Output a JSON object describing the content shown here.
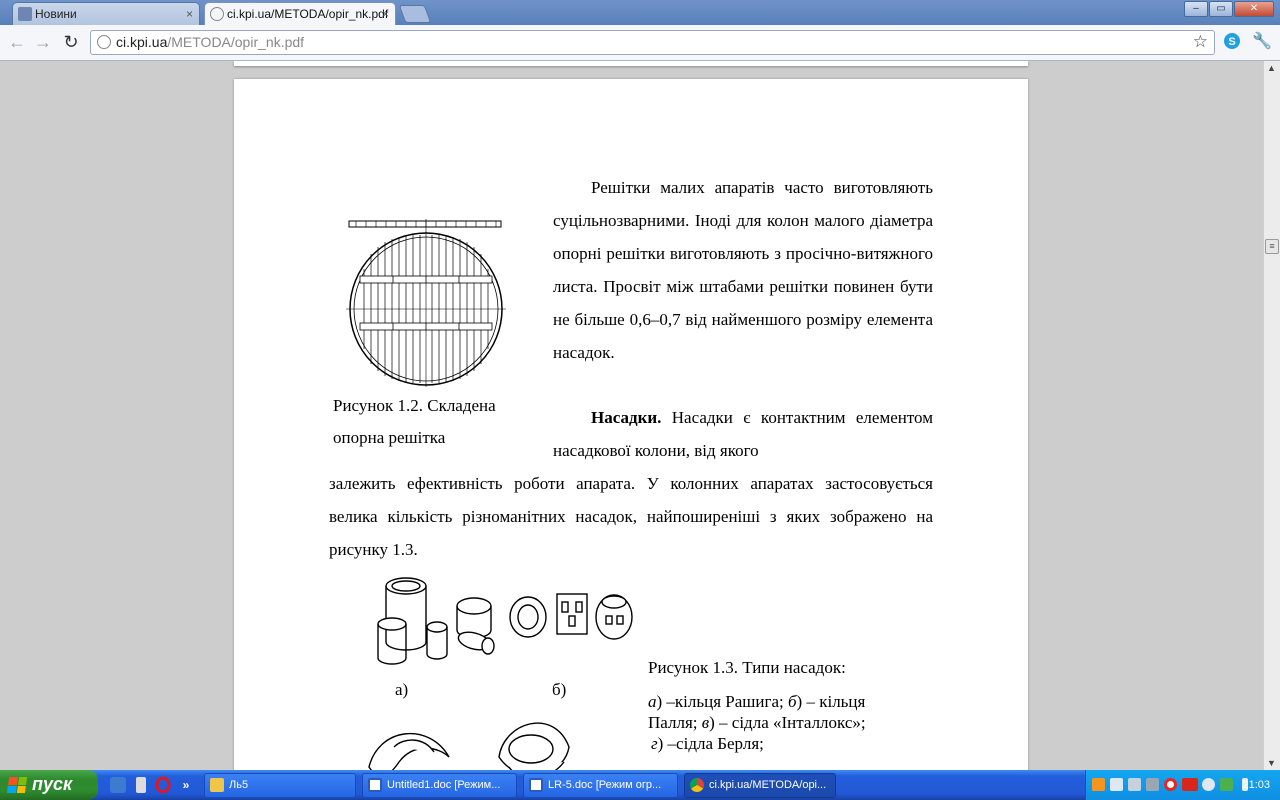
{
  "tabs": [
    {
      "label": "Новини",
      "active": false
    },
    {
      "label": "ci.kpi.ua/METODA/opir_nk.pdf",
      "active": true
    }
  ],
  "tab_close_glyph": "×",
  "window_buttons": {
    "minimize": "–",
    "maximize": "▭",
    "close": "✕"
  },
  "toolbar": {
    "back_glyph": "←",
    "forward_glyph": "→",
    "reload_glyph": "↻",
    "url_host": "ci.kpi.ua",
    "url_path": "/METODA/opir_nk.pdf",
    "star_glyph": "☆",
    "wrench_glyph": "🔧"
  },
  "document": {
    "para1": "Решітки малих апаратів часто виготовляють суцільнозварними. Іноді для колон малого діаметра опорні решітки виготовляють з просічно-витяжного листа. Просвіт між штабами решітки повинен бути не більше 0,6–0,7 від найменшого розміру елемента насадок.",
    "para2_bold": "Насадки.",
    "para2_top": "Насадки є контактним елементом насадкової колони, від якого",
    "para2_rest": "залежить ефективність роботи апарата. У колонних апаратах застосовується велика кількість різноманітних насадок, найпоширеніші з яких зображено на рисунку 1.3.",
    "fig12_caption_line1": "Рисунок 1.2. Складена",
    "fig12_caption_line2": "опорна решітка",
    "fig13_label_a": "а)",
    "fig13_label_b": "б)",
    "fig13_caption_title": "Рисунок 1.3. Типи насадок:",
    "fig13_caption_l1_a": "а",
    "fig13_caption_l1_rest": ") –кільця Рашига; ",
    "fig13_caption_l1_b": "б",
    "fig13_caption_l1_end": ") – кільця",
    "fig13_caption_l2_start": "Палля; ",
    "fig13_caption_l2_v": "в",
    "fig13_caption_l2_end": ") – сідла «Інталлокс»;",
    "fig13_caption_l3_g": "г",
    "fig13_caption_l3_end": ") –сідла Берля;"
  },
  "taskbar": {
    "start_label": "пуск",
    "quicklaunch_more": "»",
    "tasks": [
      {
        "label": "Ль5",
        "active": false
      },
      {
        "label": "Untitled1.doc [Режим...",
        "active": false
      },
      {
        "label": "LR-5.doc [Режим огр...",
        "active": false
      },
      {
        "label": "ci.kpi.ua/METODA/opi...",
        "active": true
      }
    ],
    "clock": "21:03"
  },
  "scrollbar": {
    "up": "▲",
    "down": "▼",
    "thumb": "≡"
  },
  "colors": {
    "titlebar": "#5a80bb",
    "taskbar": "#245edb",
    "start": "#2f8a2f",
    "tray": "#0f8fe2"
  }
}
